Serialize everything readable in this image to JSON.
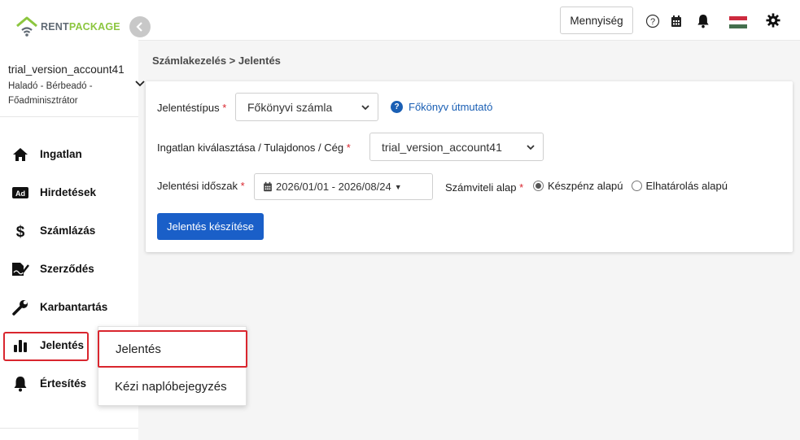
{
  "brand": {
    "rent": "RENT",
    "package": "PACKAGE",
    "accent": "#8cc63f"
  },
  "sidebar": {
    "account_name": "trial_version_account41",
    "account_role": "Haladó - Bérbeadó - Főadminisztrátor",
    "items": [
      {
        "label": "Ingatlan",
        "icon": "home-icon"
      },
      {
        "label": "Hirdetések",
        "icon": "ad-icon"
      },
      {
        "label": "Számlázás",
        "icon": "dollar-icon"
      },
      {
        "label": "Szerződés",
        "icon": "contract-icon"
      },
      {
        "label": "Karbantartás",
        "icon": "wrench-icon"
      },
      {
        "label": "Jelentés",
        "icon": "bar-chart-icon"
      },
      {
        "label": "Értesítés",
        "icon": "bell-icon"
      }
    ],
    "active_index": 5
  },
  "submenu": {
    "items": [
      "Jelentés",
      "Kézi naplóbejegyzés"
    ]
  },
  "topbar": {
    "quantity_label": "Mennyiség",
    "language": "hu"
  },
  "breadcrumb": "Számlakezelés > Jelentés",
  "form": {
    "report_type_label": "Jelentéstípus",
    "report_type_value": "Főkönyvi számla",
    "guide_link": "Főkönyv útmutató",
    "property_label": "Ingatlan kiválasztása / Tulajdonos / Cég",
    "property_value": "trial_version_account41",
    "period_label": "Jelentési időszak",
    "period_value": "2026/01/01 - 2026/08/24",
    "basis_label": "Számviteli alap",
    "basis_options": [
      "Készpénz alapú",
      "Elhatárolás alapú"
    ],
    "basis_selected": 0,
    "submit_label": "Jelentés készítése",
    "required_mark": "*"
  }
}
